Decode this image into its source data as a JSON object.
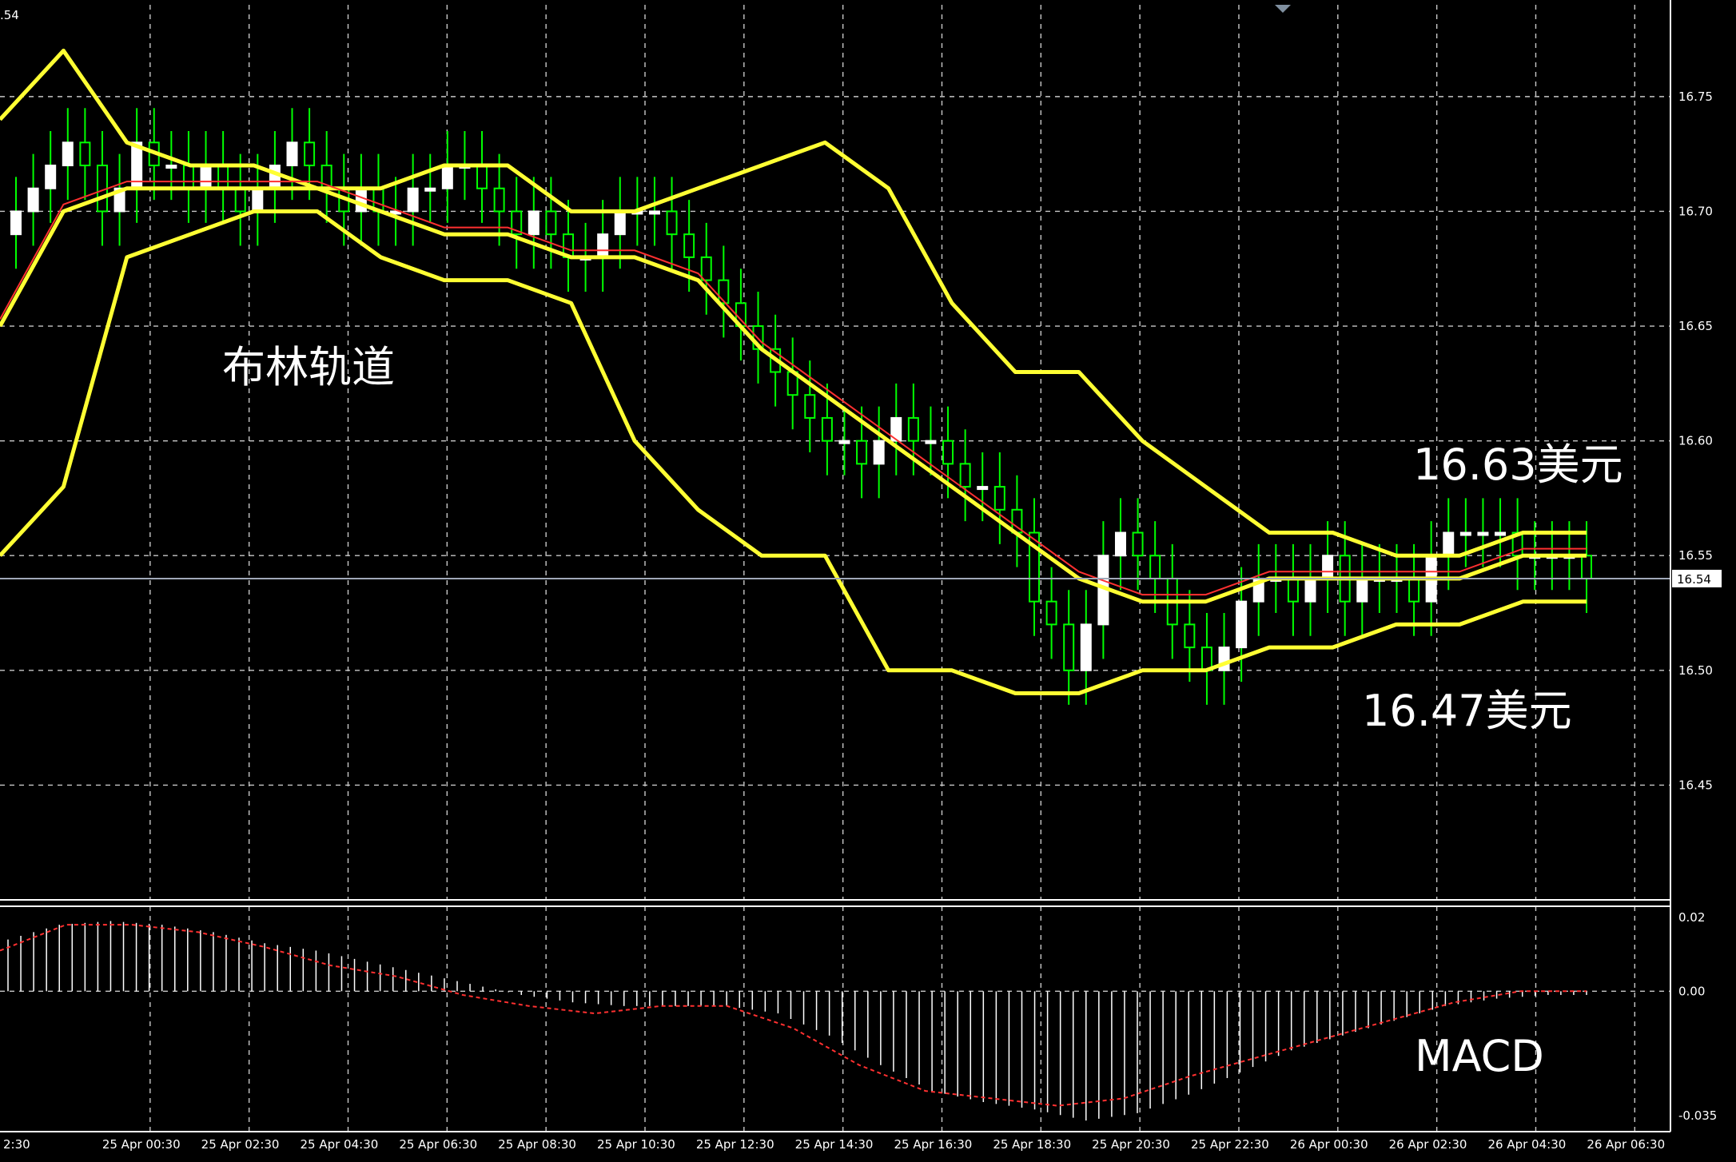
{
  "window": {
    "corner_label": ".54"
  },
  "chart_data": [
    {
      "type": "candlestick",
      "panel": "price",
      "y_ticks": [
        "16.75",
        "16.70",
        "16.65",
        "16.60",
        "16.55",
        "16.50",
        "16.45"
      ],
      "ylim": [
        16.4,
        16.79
      ],
      "current_price": "16.54",
      "x_ticks": [
        "2:30",
        "25 Apr 00:30",
        "25 Apr 02:30",
        "25 Apr 04:30",
        "25 Apr 06:30",
        "25 Apr 08:30",
        "25 Apr 10:30",
        "25 Apr 12:30",
        "25 Apr 14:30",
        "25 Apr 16:30",
        "25 Apr 18:30",
        "25 Apr 20:30",
        "25 Apr 22:30",
        "26 Apr 00:30",
        "26 Apr 02:30",
        "26 Apr 04:30",
        "26 Apr 06:30"
      ],
      "grid": true,
      "colors": {
        "up_candle": "#ffffff",
        "wick": "#00ff00",
        "bollinger": "#ffff33",
        "ma": "#ff3030",
        "grid": "#c8c8c8",
        "price_line": "#a0a8b8"
      },
      "close_trend": [
        16.7,
        16.71,
        16.72,
        16.73,
        16.72,
        16.7,
        16.71,
        16.73,
        16.72,
        16.72,
        16.71,
        16.72,
        16.71,
        16.7,
        16.71,
        16.72,
        16.73,
        16.72,
        16.71,
        16.7,
        16.71,
        16.7,
        16.7,
        16.71,
        16.71,
        16.72,
        16.72,
        16.71,
        16.7,
        16.69,
        16.7,
        16.69,
        16.68,
        16.68,
        16.69,
        16.7,
        16.7,
        16.7,
        16.69,
        16.68,
        16.67,
        16.66,
        16.65,
        16.64,
        16.63,
        16.62,
        16.61,
        16.6,
        16.6,
        16.59,
        16.6,
        16.61,
        16.6,
        16.6,
        16.59,
        16.58,
        16.58,
        16.57,
        16.56,
        16.53,
        16.52,
        16.5,
        16.52,
        16.55,
        16.56,
        16.55,
        16.54,
        16.52,
        16.51,
        16.5,
        16.51,
        16.53,
        16.54,
        16.54,
        16.53,
        16.54,
        16.55,
        16.53,
        16.54,
        16.54,
        16.54,
        16.53,
        16.55,
        16.56,
        16.56,
        16.56,
        16.56,
        16.55,
        16.55,
        16.55,
        16.55,
        16.54
      ],
      "bollinger_upper": [
        16.74,
        16.77,
        16.73,
        16.72,
        16.72,
        16.71,
        16.71,
        16.72,
        16.72,
        16.7,
        16.7,
        16.71,
        16.72,
        16.73,
        16.71,
        16.66,
        16.63,
        16.63,
        16.6,
        16.58,
        16.56,
        16.56,
        16.55,
        16.55,
        16.56,
        16.56
      ],
      "bollinger_middle": [
        16.65,
        16.7,
        16.71,
        16.71,
        16.71,
        16.71,
        16.7,
        16.69,
        16.69,
        16.68,
        16.68,
        16.67,
        16.64,
        16.62,
        16.6,
        16.58,
        16.56,
        16.54,
        16.53,
        16.53,
        16.54,
        16.54,
        16.54,
        16.54,
        16.55,
        16.55
      ],
      "bollinger_lower": [
        16.55,
        16.58,
        16.68,
        16.69,
        16.7,
        16.7,
        16.68,
        16.67,
        16.67,
        16.66,
        16.6,
        16.57,
        16.55,
        16.55,
        16.5,
        16.5,
        16.49,
        16.49,
        16.5,
        16.5,
        16.51,
        16.51,
        16.52,
        16.52,
        16.53,
        16.53
      ],
      "annotations": {
        "indicator": "布林轨道",
        "upper_label": "16.63美元",
        "lower_label": "16.47美元"
      }
    },
    {
      "type": "bar",
      "panel": "macd",
      "y_ticks": [
        "0.02",
        "0.00",
        "-0.035"
      ],
      "ylim": [
        -0.038,
        0.023
      ],
      "colors": {
        "histogram": "#ffffff",
        "signal": "#ff3030"
      },
      "histogram": [
        0.014,
        0.018,
        0.019,
        0.018,
        0.016,
        0.013,
        0.011,
        0.008,
        0.005,
        0.002,
        -0.001,
        -0.003,
        -0.004,
        -0.004,
        -0.004,
        -0.006,
        -0.012,
        -0.02,
        -0.027,
        -0.03,
        -0.032,
        -0.035,
        -0.033,
        -0.028,
        -0.022,
        -0.016,
        -0.012,
        -0.008,
        -0.004,
        -0.002,
        -0.001
      ],
      "signal": [
        0.011,
        0.018,
        0.018,
        0.016,
        0.012,
        0.007,
        0.004,
        -0.001,
        -0.004,
        -0.006,
        -0.004,
        -0.004,
        -0.01,
        -0.02,
        -0.027,
        -0.029,
        -0.031,
        -0.029,
        -0.023,
        -0.018,
        -0.013,
        -0.008,
        -0.003,
        0.0,
        0.0
      ],
      "annotations": {
        "indicator": "MACD"
      }
    }
  ]
}
